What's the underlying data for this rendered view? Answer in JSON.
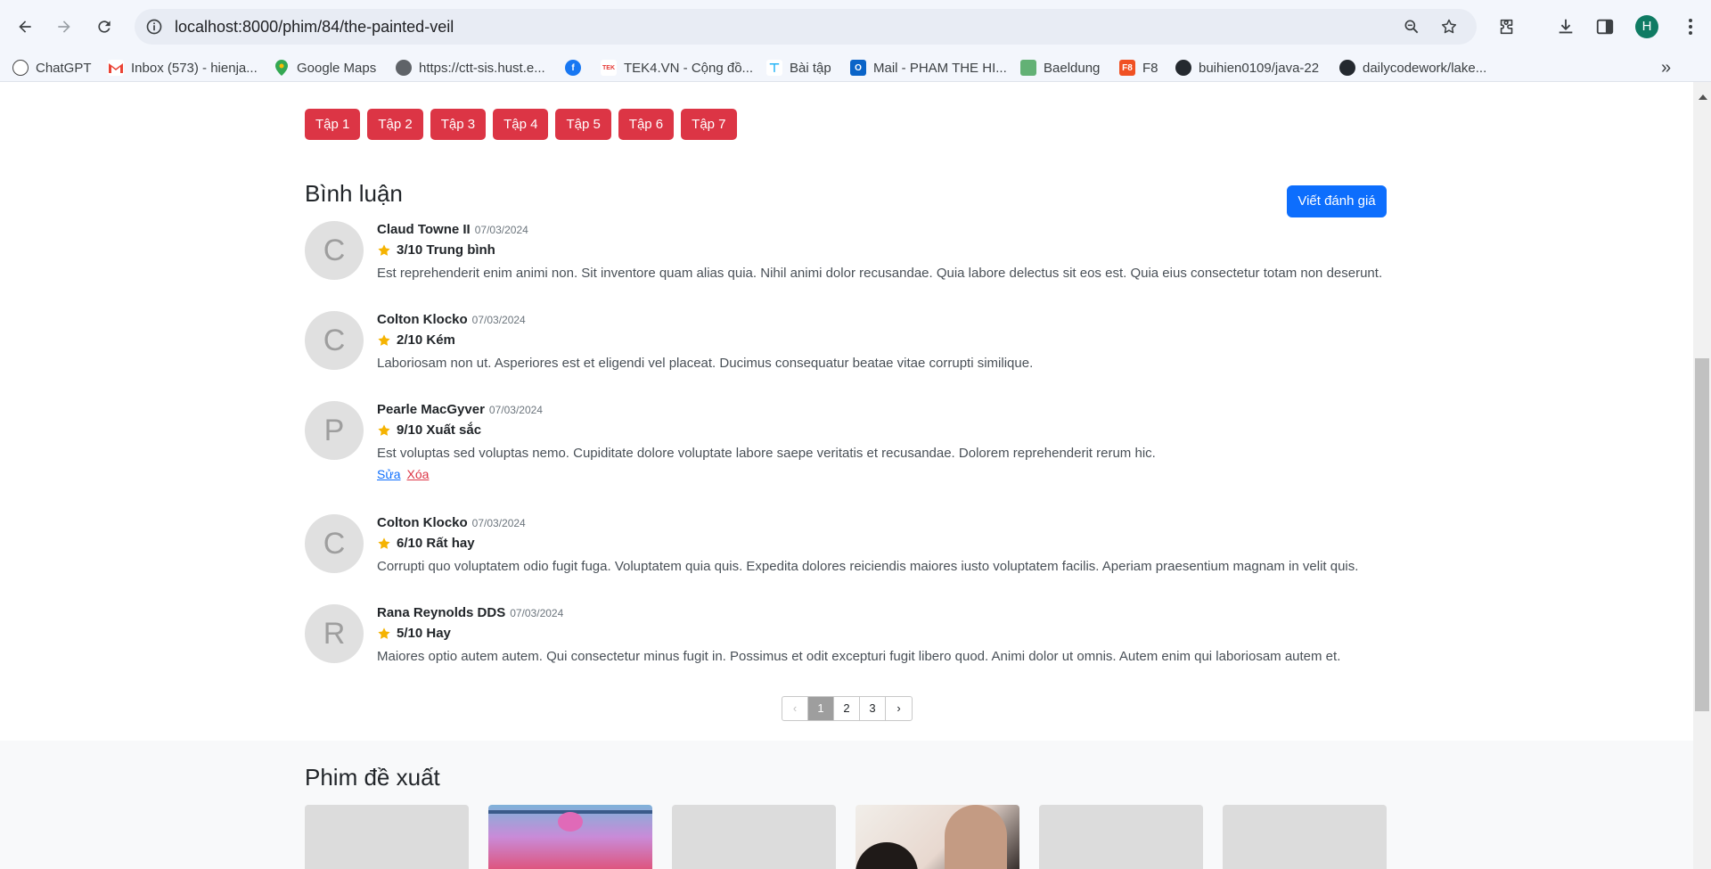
{
  "browser": {
    "url": "localhost:8000/phim/84/the-painted-veil",
    "profile_initial": "H",
    "bookmarks": [
      "ChatGPT",
      "Inbox (573) - hienja...",
      "Google Maps",
      "https://ctt-sis.hust.e...",
      "",
      "TEK4.VN - Cộng đồ...",
      "Bài tập",
      "Mail - PHAM THE HI...",
      "Baeldung",
      "F8",
      "buihien0109/java-22",
      "dailycodework/lake..."
    ],
    "bookmark_icon_labels": {
      "f8": "F8"
    }
  },
  "episodes": [
    "Tập 1",
    "Tập 2",
    "Tập 3",
    "Tập 4",
    "Tập 5",
    "Tập 6",
    "Tập 7"
  ],
  "comments_section": {
    "title": "Bình luận",
    "write_button": "Viết đánh giá",
    "comments": [
      {
        "initial": "C",
        "name": "Claud Towne II",
        "date": "07/03/2024",
        "rating": "3/10 Trung bình",
        "text": "Est reprehenderit enim animi non. Sit inventore quam alias quia. Nihil animi dolor recusandae. Quia labore delectus sit eos est. Quia eius consectetur totam non deserunt."
      },
      {
        "initial": "C",
        "name": "Colton Klocko",
        "date": "07/03/2024",
        "rating": "2/10 Kém",
        "text": "Laboriosam non ut. Asperiores est et eligendi vel placeat. Ducimus consequatur beatae vitae corrupti similique."
      },
      {
        "initial": "P",
        "name": "Pearle MacGyver",
        "date": "07/03/2024",
        "rating": "9/10 Xuất sắc",
        "text": "Est voluptas sed voluptas nemo. Cupiditate dolore voluptate labore saepe veritatis et recusandae. Dolorem reprehenderit rerum hic.",
        "edit": "Sửa",
        "delete": "Xóa"
      },
      {
        "initial": "C",
        "name": "Colton Klocko",
        "date": "07/03/2024",
        "rating": "6/10 Rất hay",
        "text": "Corrupti quo voluptatem odio fugit fuga. Voluptatem quia quis. Expedita dolores reiciendis maiores iusto voluptatem facilis. Aperiam praesentium magnam in velit quis."
      },
      {
        "initial": "R",
        "name": "Rana Reynolds DDS",
        "date": "07/03/2024",
        "rating": "5/10 Hay",
        "text": "Maiores optio autem autem. Qui consectetur minus fugit in. Possimus et odit excepturi fugit libero quod. Animi dolor ut omnis. Autem enim qui laboriosam autem et."
      }
    ],
    "pagination": {
      "prev": "‹",
      "pages": [
        "1",
        "2",
        "3"
      ],
      "next": "›",
      "current": "1"
    }
  },
  "suggested": {
    "title": "Phim đề xuất",
    "poster_count": 6
  },
  "colors": {
    "episode_button": "#dc3545",
    "primary_button": "#0d6efd",
    "star": "#f5b301"
  }
}
